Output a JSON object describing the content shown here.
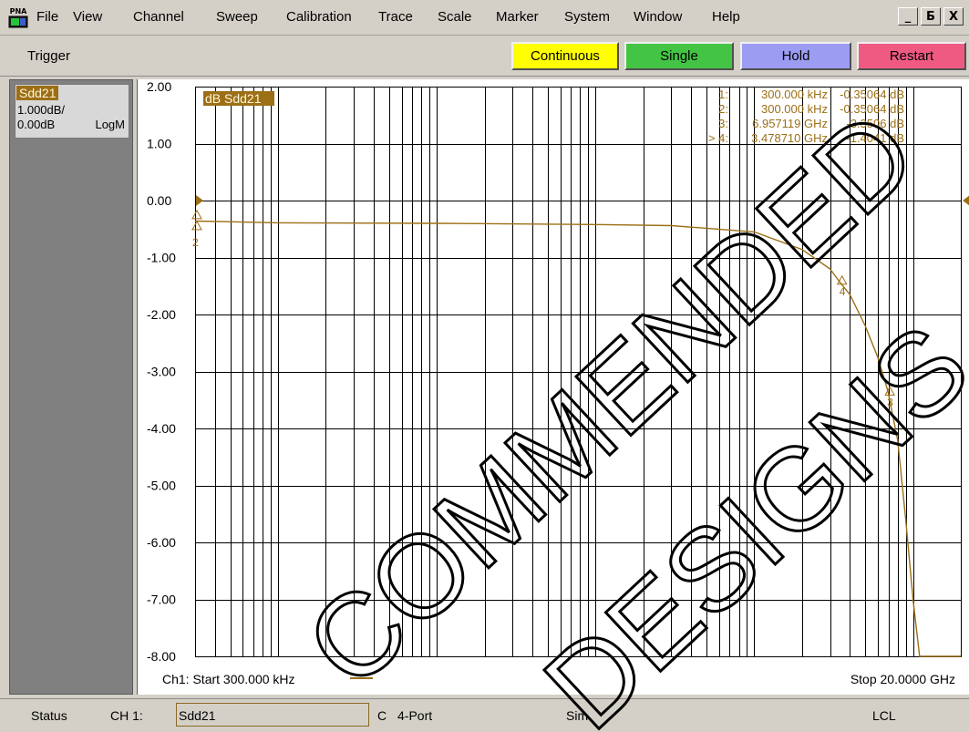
{
  "app": {
    "icon_label": "PNA",
    "menu": [
      "File",
      "View",
      "Channel",
      "Sweep",
      "Calibration",
      "Trace",
      "Scale",
      "Marker",
      "System",
      "Window",
      "Help"
    ],
    "window_buttons": [
      "_",
      "Б",
      "X"
    ]
  },
  "trigger": {
    "label": "Trigger",
    "buttons": [
      {
        "label": "Continuous",
        "color": "#ffff00"
      },
      {
        "label": "Single",
        "color": "#44c444"
      },
      {
        "label": "Hold",
        "color": "#9c9cf2"
      },
      {
        "label": "Restart",
        "color": "#ef5a82"
      }
    ]
  },
  "trace_panel": {
    "name": "Sdd21",
    "scale": "1.000dB/",
    "reference": "0.00dB",
    "format": "LogM"
  },
  "chart_data": {
    "type": "line",
    "trace_label": "dB Sdd21",
    "trace_color": "#9c6f16",
    "x_scale": "log",
    "x_range_hz": [
      300000,
      20000000000
    ],
    "ylim": [
      -8,
      2
    ],
    "y_ticks": [
      "2.00",
      "1.00",
      "0.00",
      "-1.00",
      "-2.00",
      "-3.00",
      "-4.00",
      "-5.00",
      "-6.00",
      "-7.00",
      "-8.00"
    ],
    "start_label": "Ch1: Start  300.000 kHz",
    "stop_label": "Stop  20.0000 GHz",
    "grid": true,
    "series": [
      {
        "x": [
          300000,
          1000000,
          10000000,
          100000000,
          300000000,
          1000000000,
          2000000000,
          3000000000,
          3478710000,
          4000000000,
          5000000000,
          6000000000,
          6957119000,
          8000000000,
          9000000000,
          10000000000,
          11000000000,
          12000000000,
          20000000000
        ],
        "y": [
          -0.36,
          -0.39,
          -0.4,
          -0.42,
          -0.44,
          -0.55,
          -0.86,
          -1.2,
          -1.44,
          -1.65,
          -2.2,
          -2.75,
          -3.35,
          -4.2,
          -5.6,
          -7.0,
          -8.0,
          -8.0,
          -8.0
        ]
      }
    ],
    "markers": [
      {
        "num": "1",
        "prefix": "",
        "freq": "300.000 kHz",
        "value": "-0.35064 dB",
        "x": 300000,
        "y": -0.35064
      },
      {
        "num": "2",
        "prefix": "",
        "freq": "300.000 kHz",
        "value": "-0.35064 dB",
        "x": 300000,
        "y": -0.35064
      },
      {
        "num": "3",
        "prefix": "",
        "freq": "6.957119 GHz",
        "value": "-3.3506 dB",
        "x": 6957119000,
        "y": -3.3506
      },
      {
        "num": "4",
        "prefix": ">",
        "freq": "3.478710 GHz",
        "value": "-1.4041 dB",
        "x": 3478710000,
        "y": -1.4041
      }
    ]
  },
  "status": {
    "label": "Status",
    "channel": "CH 1:",
    "measurement": "Sdd21",
    "cal": "C",
    "topology": "4-Port",
    "mode": "Sim",
    "remote": "LCL"
  },
  "watermark": [
    "COMMENDED",
    "DESIGNS"
  ]
}
